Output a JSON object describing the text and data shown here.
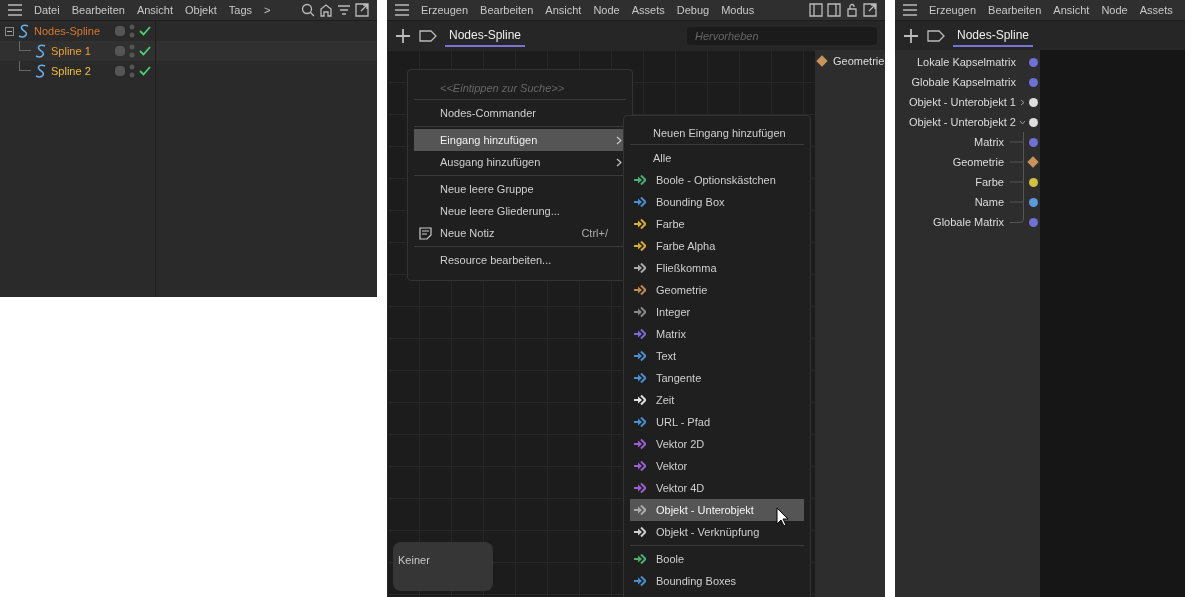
{
  "object_manager": {
    "menu": [
      "Datei",
      "Bearbeiten",
      "Ansicht",
      "Objekt",
      "Tags",
      ">"
    ],
    "tree": [
      {
        "name": "Nodes-Spline",
        "color": "#d8782a",
        "expanded": true,
        "children": [
          {
            "name": "Spline 1",
            "color": "#f0a030"
          },
          {
            "name": "Spline 2",
            "color": "#f0c030"
          }
        ]
      }
    ]
  },
  "node_editor": {
    "menu": [
      "Erzeugen",
      "Bearbeiten",
      "Ansicht",
      "Node",
      "Assets",
      "Debug",
      "Modus"
    ],
    "tab": {
      "label": "Nodes-Spline",
      "selected": true
    },
    "search": {
      "placeholder": "Hervorheben"
    },
    "output_ports": [
      {
        "label": "Geometrie",
        "color": "#c8945a",
        "kind": "diamond"
      }
    ],
    "context_menu": {
      "search_placeholder": "<<Eintippen zur Suche>>",
      "sections": [
        [
          {
            "label": "Nodes-Commander",
            "selected": false
          }
        ],
        [
          {
            "label": "Eingang hinzufügen",
            "selected": true,
            "submenu": true
          },
          {
            "label": "Ausgang hinzufügen",
            "selected": false,
            "submenu": true
          }
        ],
        [
          {
            "label": "Neue leere Gruppe",
            "selected": false
          },
          {
            "label": "Neue leere Gliederung...",
            "selected": false
          },
          {
            "label": "Neue Notiz",
            "selected": false,
            "kind": "note",
            "shortcut": "Ctrl+/"
          }
        ],
        [
          {
            "label": "Resource bearbeiten...",
            "selected": false
          }
        ]
      ]
    },
    "submenu": {
      "title": "Neuen Eingang hinzufügen",
      "all_label": "Alle",
      "groups": [
        [
          {
            "label": "Boole - Optionskästchen",
            "color": "#4caf70",
            "selected": false
          },
          {
            "label": "Bounding Box",
            "color": "#4a8fd0",
            "selected": false
          },
          {
            "label": "Farbe",
            "color": "#d4b030",
            "selected": false
          },
          {
            "label": "Farbe Alpha",
            "color": "#d4b030",
            "selected": false
          },
          {
            "label": "Fließkomma",
            "color": "#aaaaaa",
            "selected": false
          },
          {
            "label": "Geometrie",
            "color": "#c08a50",
            "selected": false
          },
          {
            "label": "Integer",
            "color": "#888888",
            "selected": false
          },
          {
            "label": "Matrix",
            "color": "#7a6ad8",
            "selected": false
          },
          {
            "label": "Text",
            "color": "#4a8fd0",
            "selected": false
          },
          {
            "label": "Tangente",
            "color": "#4a8fd0",
            "selected": false
          },
          {
            "label": "Zeit",
            "color": "#e0e0e0",
            "selected": false
          },
          {
            "label": "URL - Pfad",
            "color": "#4a8fd0",
            "selected": false
          },
          {
            "label": "Vektor 2D",
            "color": "#9a60d0",
            "selected": false
          },
          {
            "label": "Vektor",
            "color": "#9a60d0",
            "selected": false
          },
          {
            "label": "Vektor 4D",
            "color": "#9a60d0",
            "selected": false
          },
          {
            "label": "Objekt - Unterobjekt",
            "color": "#aaaaaa",
            "selected": true
          },
          {
            "label": "Objekt - Verknüpfung",
            "color": "#cccccc",
            "selected": false
          }
        ],
        [
          {
            "label": "Boole",
            "color": "#4caf70",
            "selected": false
          },
          {
            "label": "Bounding Boxes",
            "color": "#4a8fd0",
            "selected": false
          }
        ]
      ]
    },
    "note": {
      "label": "Keiner"
    }
  },
  "port_editor": {
    "menu": [
      "Erzeugen",
      "Bearbeiten",
      "Ansicht",
      "Node",
      "Assets"
    ],
    "tab": {
      "label": "Nodes-Spline",
      "selected": true
    },
    "ports": [
      {
        "label": "Lokale Kapselmatrix",
        "color": "#6f6fd8",
        "kind": "dot"
      },
      {
        "label": "Globale Kapselmatrix",
        "color": "#6f6fd8",
        "kind": "dot"
      },
      {
        "label": "Objekt - Unterobjekt 1",
        "color": "#dddddd",
        "kind": "dot",
        "expanded": false
      },
      {
        "label": "Objekt - Unterobjekt 2",
        "color": "#dddddd",
        "kind": "dot",
        "expanded": true,
        "children": [
          {
            "label": "Matrix",
            "color": "#6f6fd8",
            "kind": "dot"
          },
          {
            "label": "Geometrie",
            "color": "#c8945a",
            "kind": "diamond"
          },
          {
            "label": "Farbe",
            "color": "#d4c040",
            "kind": "dot"
          },
          {
            "label": "Name",
            "color": "#5a9ad8",
            "kind": "dot"
          },
          {
            "label": "Globale Matrix",
            "color": "#6f6fd8",
            "kind": "dot"
          }
        ]
      }
    ]
  }
}
